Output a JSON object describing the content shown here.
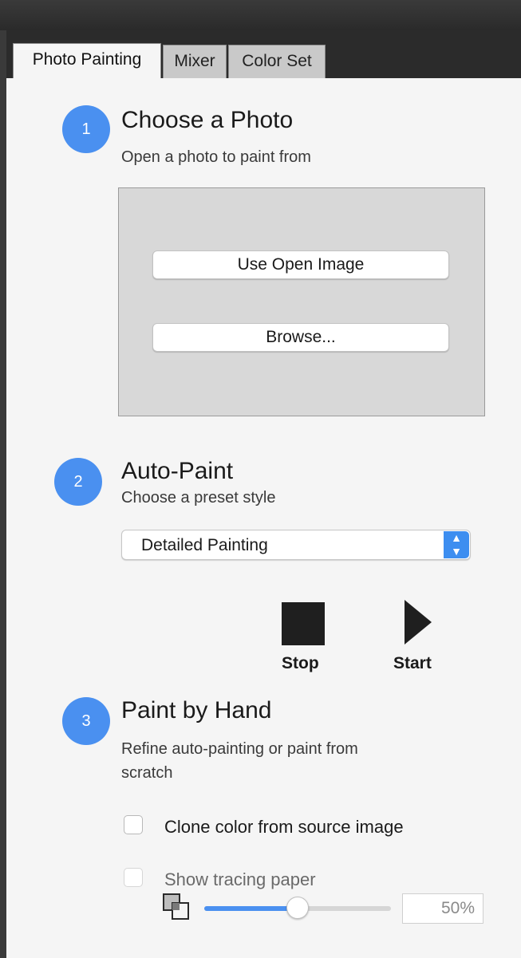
{
  "tabs": [
    {
      "label": "Photo Painting",
      "active": true
    },
    {
      "label": "Mixer",
      "active": false
    },
    {
      "label": "Color Set",
      "active": false
    }
  ],
  "step1": {
    "number": "1",
    "title": "Choose a Photo",
    "subtitle": "Open a photo to paint from",
    "use_open_image_label": "Use Open Image",
    "browse_label": "Browse..."
  },
  "step2": {
    "number": "2",
    "title": "Auto-Paint",
    "subtitle": "Choose a preset style",
    "preset_selected": "Detailed Painting",
    "stop_label": "Stop",
    "start_label": "Start"
  },
  "step3": {
    "number": "3",
    "title": "Paint by Hand",
    "subtitle_line1": "Refine auto-painting or paint from",
    "subtitle_line2": "scratch",
    "clone_color_label": "Clone color from source image",
    "clone_color_checked": false,
    "tracing_paper_label": "Show tracing paper",
    "tracing_paper_checked": false,
    "tracing_paper_enabled": false,
    "opacity_value": 0.5,
    "opacity_text": "50%"
  },
  "icons": {
    "step_badge": "numbered-circle",
    "dropdown": "chevron-up-down-icon",
    "stop": "stop-square-icon",
    "start": "play-triangle-icon",
    "opacity": "overlapping-squares-icon"
  },
  "colors": {
    "accent": "#4a90f0",
    "panel_bg": "#f5f5f5",
    "photo_box_bg": "#d8d8d8",
    "title_bar": "#2b2b2b"
  }
}
